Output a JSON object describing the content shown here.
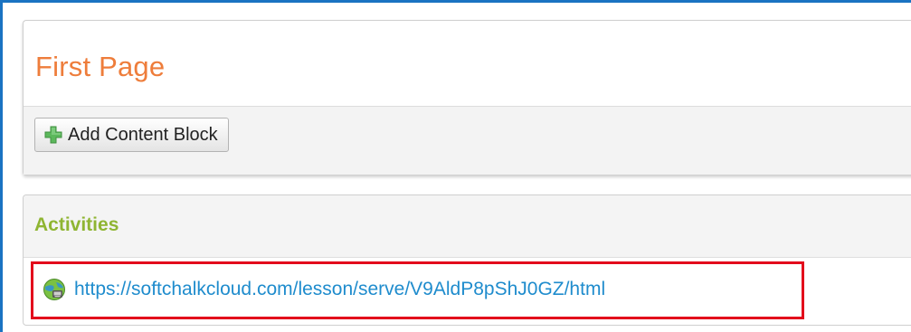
{
  "page": {
    "title": "First Page",
    "toolbar": {
      "add_button_label": "Add Content Block",
      "add_button_icon": "plus-icon"
    }
  },
  "activities": {
    "heading": "Activities",
    "items": [
      {
        "icon": "globe-icon",
        "url": "https://softchalkcloud.com/lesson/serve/V9AldP8pShJ0GZ/html"
      }
    ]
  },
  "colors": {
    "frame_border": "#1a73c2",
    "page_title": "#ee7d3b",
    "activities_heading": "#8fb532",
    "link": "#1f8ccd",
    "highlight_box": "#e30b1c",
    "plus_icon": "#5cb85c"
  }
}
